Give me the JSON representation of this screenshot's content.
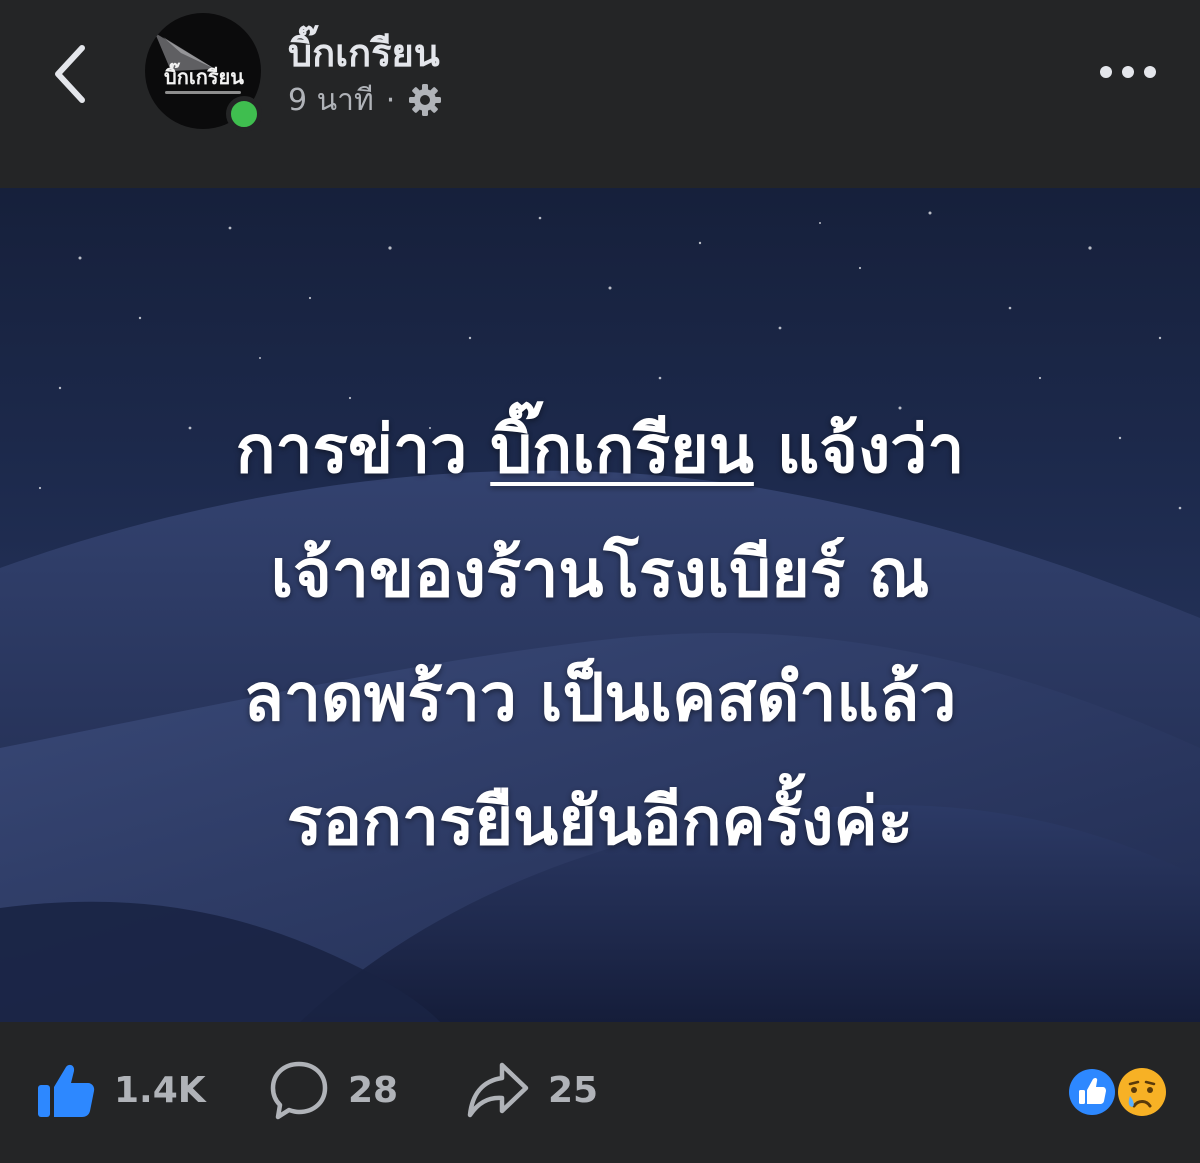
{
  "header": {
    "page_name": "บิ๊กเกรียน",
    "avatar_text": "บิ๊กเกรียน",
    "time": "9 นาที",
    "separator": "·"
  },
  "post": {
    "line1_before": "การข่าว ",
    "mention": "บิ๊กเกรียน",
    "line1_after": " แจ้งว่า",
    "line2": "เจ้าของร้านโรงเบียร์ ณ",
    "line3": "ลาดพร้าว เป็นเคสดำแล้ว",
    "line4": "รอการยืนยันอีกครั้งค่ะ"
  },
  "actions": {
    "likes": "1.4K",
    "comments": "28",
    "shares": "25"
  },
  "icons": [
    "back-chevron-icon",
    "gear-icon",
    "more-icon",
    "like-icon",
    "comment-icon",
    "share-icon",
    "like-reaction-icon",
    "sad-reaction-icon"
  ],
  "colors": {
    "background": "#242526",
    "like_blue": "#2d88ff",
    "online_green": "#3fbe4f",
    "sad_yellow": "#f7b125"
  }
}
